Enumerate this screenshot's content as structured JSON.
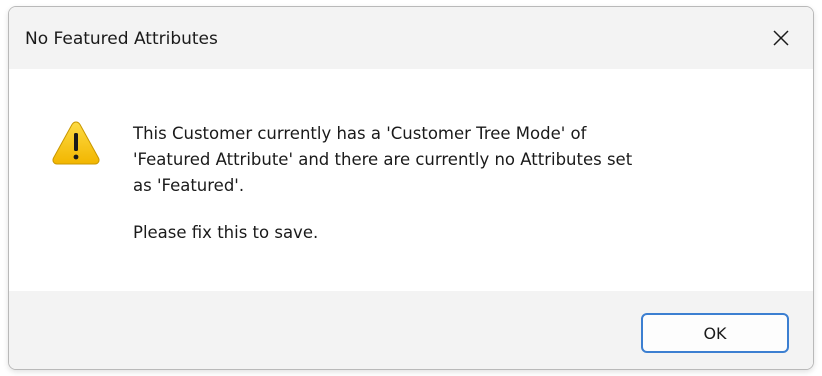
{
  "dialog": {
    "title": "No Featured Attributes",
    "close_icon": "close-icon",
    "warning_icon": "warning-icon",
    "warning_color": "#f7c600",
    "message_lines": [
      "This Customer currently has a 'Customer Tree Mode' of",
      "'Featured Attribute' and there are currently no Attributes set",
      "as 'Featured'."
    ],
    "message_followup": "Please fix this to save.",
    "ok_label": "OK",
    "accent_color": "#3c7fd1"
  }
}
